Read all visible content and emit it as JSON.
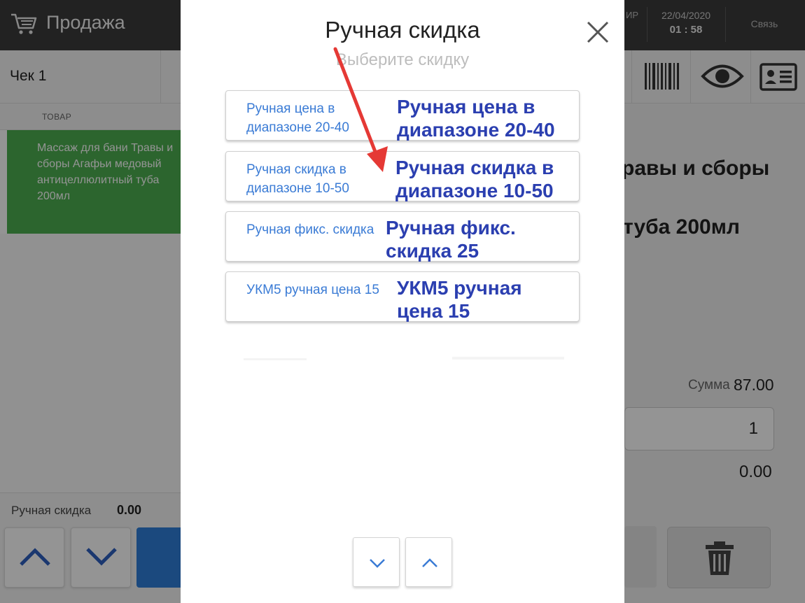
{
  "app": {
    "title": "Продажа",
    "status_ip": "ИР",
    "date": "22/04/2020",
    "time": "01 : 58",
    "link_label": "Связь"
  },
  "check": {
    "tab_label": "Чек 1",
    "column_header": "ТОВАР",
    "item_name": "Массаж для бани Травы и сборы Агафьи медовый антицеллюлитный туба 200мл",
    "discount_label": "Ручная скидка",
    "discount_value": "0.00"
  },
  "product": {
    "line1": "равы и сборы",
    "line2": "туба 200мл",
    "sum_label": "Сумма",
    "sum_value": "87.00",
    "quantity": "1",
    "discount": "0.00"
  },
  "modal": {
    "title": "Ручная скидка",
    "subtitle": "Выберите скидку",
    "options": [
      {
        "label": "Ручная цена в диапазоне 20-40",
        "annotation_line1": "Ручная цена в",
        "annotation_line2": "диапазоне 20-40"
      },
      {
        "label": "Ручная скидка в диапазоне 10-50",
        "annotation_line1": "Ручная скидка в",
        "annotation_line2": "диапазоне 10-50"
      },
      {
        "label": "Ручная фикс. скидка",
        "annotation_line1": "Ручная фикс.",
        "annotation_line2": "скидка 25"
      },
      {
        "label": "УКМ5 ручная цена 15",
        "annotation_line1": "УКМ5 ручная",
        "annotation_line2": "цена 15"
      }
    ]
  },
  "colors": {
    "topbar": "#3b3b3b",
    "selected_item": "#4caf50",
    "option_label": "#3a7bd5",
    "annotation": "#2b3fb0",
    "pointer_arrow": "#e53935",
    "accent_button": "#2f7fd9"
  },
  "icons": [
    "cart-icon",
    "close-icon",
    "chevron-up-icon",
    "chevron-down-icon",
    "barcode-icon",
    "eye-icon",
    "id-card-icon",
    "trash-icon"
  ]
}
